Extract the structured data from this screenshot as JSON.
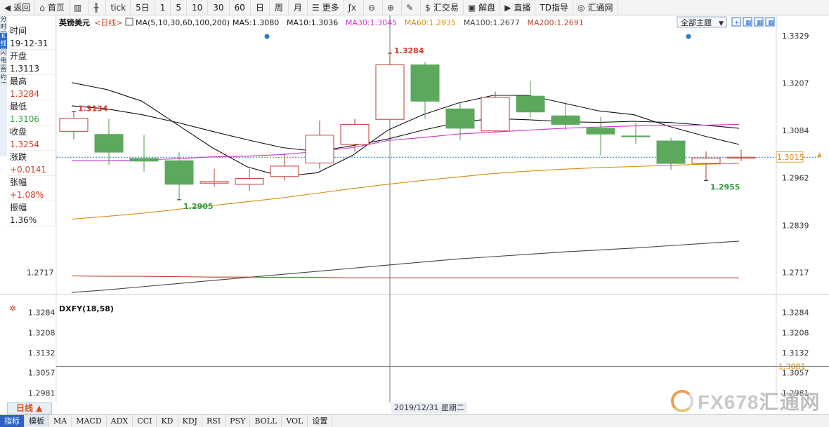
{
  "toolbar": {
    "items": [
      {
        "label": "返回",
        "icon": "back-arrow-icon",
        "glyph": "◀"
      },
      {
        "label": "首页",
        "icon": "home-icon",
        "glyph": "⌂"
      },
      {
        "label": "",
        "icon": "bar-chart-icon",
        "glyph": "▥"
      },
      {
        "label": "",
        "icon": "candlestick-icon",
        "glyph": "╫"
      },
      {
        "label": "tick",
        "icon": "",
        "glyph": ""
      },
      {
        "label": "5日",
        "icon": "",
        "glyph": ""
      },
      {
        "label": "1",
        "icon": "",
        "glyph": ""
      },
      {
        "label": "5",
        "icon": "",
        "glyph": ""
      },
      {
        "label": "10",
        "icon": "",
        "glyph": ""
      },
      {
        "label": "30",
        "icon": "",
        "glyph": ""
      },
      {
        "label": "60",
        "icon": "",
        "glyph": ""
      },
      {
        "label": "日",
        "icon": "",
        "glyph": ""
      },
      {
        "label": "周",
        "icon": "",
        "glyph": ""
      },
      {
        "label": "月",
        "icon": "",
        "glyph": ""
      },
      {
        "label": "更多",
        "icon": "list-icon",
        "glyph": "☰"
      },
      {
        "label": "",
        "icon": "fx-icon",
        "glyph": "ƒx"
      },
      {
        "label": "",
        "icon": "zoom-out-icon",
        "glyph": "⊖"
      },
      {
        "label": "",
        "icon": "zoom-in-icon",
        "glyph": "⊕"
      },
      {
        "label": "",
        "icon": "pencil-icon",
        "glyph": "✎"
      },
      {
        "label": "汇交易",
        "icon": "dollar-icon",
        "glyph": "$"
      },
      {
        "label": "解盘",
        "icon": "chat-icon",
        "glyph": "▣"
      },
      {
        "label": "直播",
        "icon": "play-icon",
        "glyph": "▶"
      },
      {
        "label": "TD指导",
        "icon": "",
        "glyph": ""
      },
      {
        "label": "汇通网",
        "icon": "logo-icon",
        "glyph": "◎"
      }
    ]
  },
  "side_tabs": [
    "分时图",
    "K线图",
    "闪电图",
    "合约资料"
  ],
  "info_panel": [
    {
      "label": "时间",
      "value": "19-12-31",
      "tone": "normal"
    },
    {
      "label": "开盘",
      "value": "1.3113",
      "tone": "normal"
    },
    {
      "label": "最高",
      "value": "1.3284",
      "tone": "red"
    },
    {
      "label": "最低",
      "value": "1.3106",
      "tone": "green"
    },
    {
      "label": "收盘",
      "value": "1.3254",
      "tone": "red"
    },
    {
      "label": "涨跌",
      "value": "+0.0141",
      "tone": "red"
    },
    {
      "label": "张幅",
      "value": "+1.08%",
      "tone": "red"
    },
    {
      "label": "振幅",
      "value": "1.36%",
      "tone": "normal"
    }
  ],
  "chart_data": {
    "type": "candlestick",
    "title": "英镑美元",
    "period_tag": "<日线>",
    "ma_header": "MA(5,10,30,60,100,200)",
    "ma_values": [
      {
        "label": "MA5:1.3080",
        "color": "#111111"
      },
      {
        "label": "MA10:1.3036",
        "color": "#111111"
      },
      {
        "label": "MA30:1.3045",
        "color": "#cc33cc"
      },
      {
        "label": "MA60:1.2935",
        "color": "#d88a12"
      },
      {
        "label": "MA100:1.2677",
        "color": "#444444"
      },
      {
        "label": "MA200:1.2691",
        "color": "#b5452a"
      }
    ],
    "theme_button": "全部主题",
    "y_ticks_right": [
      "1.3329",
      "1.3207",
      "1.3084",
      "1.2962",
      "1.2839",
      "1.2717"
    ],
    "y_ticks_left": [
      "1.2717"
    ],
    "y_range": [
      1.266,
      1.336
    ],
    "current_price": "1.3015",
    "current_price_value": 1.3015,
    "candles": [
      {
        "o": 1.3082,
        "h": 1.3134,
        "l": 1.3062,
        "c": 1.3116
      },
      {
        "o": 1.3074,
        "h": 1.3114,
        "l": 1.2995,
        "c": 1.3028
      },
      {
        "o": 1.3012,
        "h": 1.3072,
        "l": 1.2978,
        "c": 1.3005
      },
      {
        "o": 1.3006,
        "h": 1.3028,
        "l": 1.2905,
        "c": 1.2945
      },
      {
        "o": 1.2948,
        "h": 1.2985,
        "l": 1.2938,
        "c": 1.2952
      },
      {
        "o": 1.2945,
        "h": 1.2985,
        "l": 1.2928,
        "c": 1.296
      },
      {
        "o": 1.2965,
        "h": 1.3025,
        "l": 1.2955,
        "c": 1.2992
      },
      {
        "o": 1.3,
        "h": 1.311,
        "l": 1.2985,
        "c": 1.3072
      },
      {
        "o": 1.3048,
        "h": 1.3114,
        "l": 1.303,
        "c": 1.31
      },
      {
        "o": 1.3113,
        "h": 1.3284,
        "l": 1.3106,
        "c": 1.3254
      },
      {
        "o": 1.3254,
        "h": 1.3262,
        "l": 1.3115,
        "c": 1.316
      },
      {
        "o": 1.314,
        "h": 1.3155,
        "l": 1.306,
        "c": 1.309
      },
      {
        "o": 1.3083,
        "h": 1.3185,
        "l": 1.308,
        "c": 1.317
      },
      {
        "o": 1.3173,
        "h": 1.3213,
        "l": 1.3118,
        "c": 1.3132
      },
      {
        "o": 1.3122,
        "h": 1.3158,
        "l": 1.3085,
        "c": 1.31
      },
      {
        "o": 1.309,
        "h": 1.312,
        "l": 1.302,
        "c": 1.3075
      },
      {
        "o": 1.307,
        "h": 1.3105,
        "l": 1.305,
        "c": 1.3068
      },
      {
        "o": 1.3057,
        "h": 1.3065,
        "l": 1.2982,
        "c": 1.2999
      },
      {
        "o": 1.2999,
        "h": 1.303,
        "l": 1.2955,
        "c": 1.3013
      },
      {
        "o": 1.3015,
        "h": 1.3035,
        "l": 1.3005,
        "c": 1.3015
      }
    ],
    "annotations": [
      {
        "index": 0,
        "price": 1.3134,
        "text": "1.3134",
        "pos": "above",
        "color": "#d63a2a"
      },
      {
        "index": 3,
        "price": 1.2905,
        "text": "1.2905",
        "pos": "below",
        "color": "#2f9c3d"
      },
      {
        "index": 9,
        "price": 1.3284,
        "text": "1.3284",
        "pos": "above",
        "color": "#d63a2a"
      },
      {
        "index": 18,
        "price": 1.2955,
        "text": "1.2955",
        "pos": "below",
        "color": "#2f9c3d"
      }
    ],
    "event_dots": [
      5.5,
      17.5
    ],
    "ma_lines": [
      {
        "name": "MA5",
        "color": "#111111",
        "values": [
          1.3208,
          1.319,
          1.316,
          1.31,
          1.304,
          1.299,
          1.2965,
          1.2975,
          1.302,
          1.3085,
          1.3125,
          1.3155,
          1.3175,
          1.3175,
          1.3155,
          1.3135,
          1.3125,
          1.3095,
          1.307,
          1.3048
        ]
      },
      {
        "name": "MA10",
        "color": "#111111",
        "values": [
          1.3148,
          1.314,
          1.3125,
          1.3105,
          1.3082,
          1.306,
          1.304,
          1.303,
          1.3045,
          1.3062,
          1.3085,
          1.3105,
          1.3115,
          1.3112,
          1.3107,
          1.3105,
          1.3108,
          1.3105,
          1.3098,
          1.309
        ]
      },
      {
        "name": "MA30",
        "color": "#cc33cc",
        "values": [
          1.3006,
          1.3006,
          1.3008,
          1.3011,
          1.3016,
          1.3018,
          1.3022,
          1.303,
          1.304,
          1.3058,
          1.3066,
          1.3075,
          1.308,
          1.3085,
          1.309,
          1.3093,
          1.3096,
          1.3097,
          1.3098,
          1.31
        ]
      },
      {
        "name": "MA60",
        "color": "#d88a12",
        "values": [
          1.2855,
          1.2862,
          1.287,
          1.288,
          1.289,
          1.29,
          1.291,
          1.2922,
          1.2934,
          1.2945,
          1.2955,
          1.2964,
          1.2973,
          1.2979,
          1.2984,
          1.2988,
          1.2991,
          1.2994,
          1.2997,
          1.2999
        ]
      },
      {
        "name": "MA100",
        "color": "#444444",
        "values": [
          1.2665,
          1.2672,
          1.268,
          1.2688,
          1.2696,
          1.2704,
          1.2712,
          1.272,
          1.2728,
          1.2736,
          1.2744,
          1.2752,
          1.2758,
          1.2764,
          1.277,
          1.2775,
          1.278,
          1.2786,
          1.2792,
          1.2798
        ]
      },
      {
        "name": "MA200",
        "color": "#b5452a",
        "values": [
          1.2708,
          1.2707,
          1.2707,
          1.2706,
          1.2705,
          1.2705,
          1.2704,
          1.2704,
          1.2703,
          1.2703,
          1.2703,
          1.2703,
          1.2703,
          1.2703,
          1.2703,
          1.2703,
          1.2703,
          1.2703,
          1.2703,
          1.2703
        ]
      }
    ],
    "sub": {
      "title": "DXFY(18,58)",
      "y_ticks": [
        "1.3284",
        "1.3208",
        "1.3132",
        "1.3057",
        "1.2981"
      ],
      "y_range": [
        1.2945,
        1.332
      ],
      "line_value": 1.3081,
      "line_label": "1.3081"
    },
    "crosshair_index": 9,
    "crosshair_date": "2019/12/31 星期二",
    "period_button": "日线 ▲",
    "colors": {
      "up": "#c0392b",
      "down": "#5ca85c",
      "grid": "#e6e6e6",
      "current_line": "#2a7bc4"
    }
  },
  "indicator_tabs": [
    "指标",
    "模板",
    "MA",
    "MACD",
    "ADX",
    "CCI",
    "KD",
    "KDJ",
    "RSI",
    "PSY",
    "BOLL",
    "VOL",
    "设置"
  ],
  "watermark": {
    "brand": "FX678",
    "cn": "汇通网"
  }
}
